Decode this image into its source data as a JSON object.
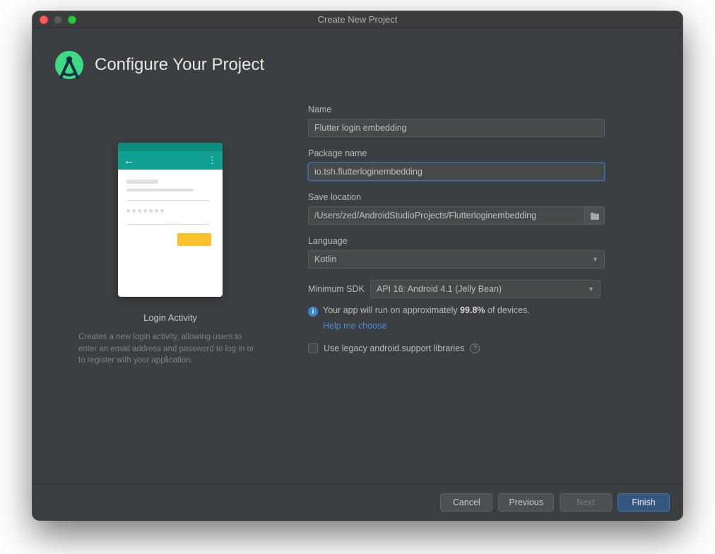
{
  "window": {
    "title": "Create New Project"
  },
  "header": {
    "title": "Configure Your Project"
  },
  "preview": {
    "caption": "Login Activity",
    "description": "Creates a new login activity, allowing users to enter an email address and password to log in or to register with your application."
  },
  "form": {
    "name_label": "Name",
    "name_value": "Flutter login embedding",
    "package_label": "Package name",
    "package_value": "io.tsh.flutterloginembedding",
    "location_label": "Save location",
    "location_value": "/Users/zed/AndroidStudioProjects/Flutterloginembedding",
    "language_label": "Language",
    "language_value": "Kotlin",
    "minsdk_label": "Minimum SDK",
    "minsdk_value": "API 16: Android 4.1 (Jelly Bean)",
    "info_prefix": "Your app will run on approximately ",
    "info_pct": "99.8%",
    "info_suffix": " of devices.",
    "help_link": "Help me choose",
    "legacy_label": "Use legacy android.support libraries"
  },
  "footer": {
    "cancel": "Cancel",
    "previous": "Previous",
    "next": "Next",
    "finish": "Finish"
  }
}
